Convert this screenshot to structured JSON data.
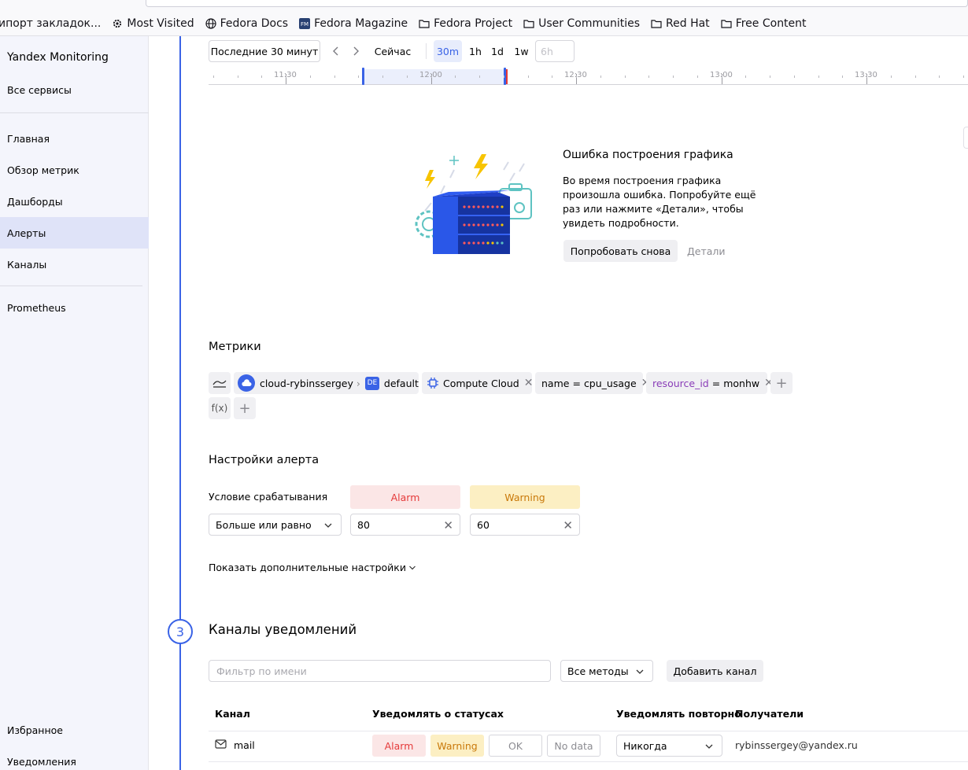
{
  "bookmarks": [
    {
      "label": "ипорт закладок...",
      "icon": "none"
    },
    {
      "label": "Most Visited",
      "icon": "gear-icon"
    },
    {
      "label": "Fedora Docs",
      "icon": "globe-icon"
    },
    {
      "label": "Fedora Magazine",
      "icon": "fm-icon"
    },
    {
      "label": "Fedora Project",
      "icon": "folder-icon"
    },
    {
      "label": "User Communities",
      "icon": "folder-icon"
    },
    {
      "label": "Red Hat",
      "icon": "folder-icon"
    },
    {
      "label": "Free Content",
      "icon": "folder-icon"
    }
  ],
  "sidebar": {
    "brand": "Yandex Monitoring",
    "all_services": "Все сервисы",
    "items": [
      {
        "label": "Главная"
      },
      {
        "label": "Обзор метрик"
      },
      {
        "label": "Дашборды"
      },
      {
        "label": "Алерты"
      },
      {
        "label": "Каналы"
      }
    ],
    "prometheus": "Prometheus",
    "favorites": "Избранное",
    "notifications": "Уведомления"
  },
  "time": {
    "range": "Последние 30 минут",
    "now": "Сейчас",
    "scales": [
      "30m",
      "1h",
      "1d",
      "1w"
    ],
    "active_scale": "30m",
    "custom_placeholder": "6h",
    "ticks": [
      "11:30",
      "12:00",
      "12:30",
      "13:00",
      "13:30"
    ]
  },
  "error": {
    "title": "Ошибка построения графика",
    "text": "Во время построения графика произошла ошибка. Попробуйте ещё раз или нажмите «Детали», чтобы увидеть подробности.",
    "retry": "Попробовать снова",
    "details": "Детали"
  },
  "metrics": {
    "title": "Метрики",
    "cloud": "cloud-rybinssergey",
    "folder_badge": "DE",
    "folder": "default",
    "service": "Compute Cloud",
    "label1_key": "name",
    "label1_op": "=",
    "label1_val": "cpu_usage",
    "label2_key": "resource_id",
    "label2_op": "=",
    "label2_val": "monhw",
    "func": "f(x)"
  },
  "alert": {
    "title": "Настройки алерта",
    "condition_label": "Условие срабатывания",
    "alarm": "Alarm",
    "warning": "Warning",
    "comparison": "Больше или равно",
    "alarm_value": "80",
    "warning_value": "60",
    "more_settings": "Показать дополнительные настройки"
  },
  "channels": {
    "step": "3",
    "title": "Каналы уведомлений",
    "filter_placeholder": "Фильтр по имени",
    "methods": "Все методы",
    "add": "Добавить канал",
    "headers": {
      "channel": "Канал",
      "statuses": "Уведомлять о статусах",
      "repeat": "Уведомлять повторно",
      "recipients": "Получатели"
    },
    "row": {
      "name": "mail",
      "alarm": "Alarm",
      "warning": "Warning",
      "ok": "OK",
      "nodata": "No data",
      "repeat": "Никогда",
      "recipient": "rybinssergey@yandex.ru"
    }
  },
  "colors": {
    "accent": "#3a63e6",
    "alarm_bg": "#fbe6e6",
    "alarm_fg": "#e53a3a",
    "warn_bg": "#fcefc3",
    "warn_fg": "#c9790a"
  }
}
